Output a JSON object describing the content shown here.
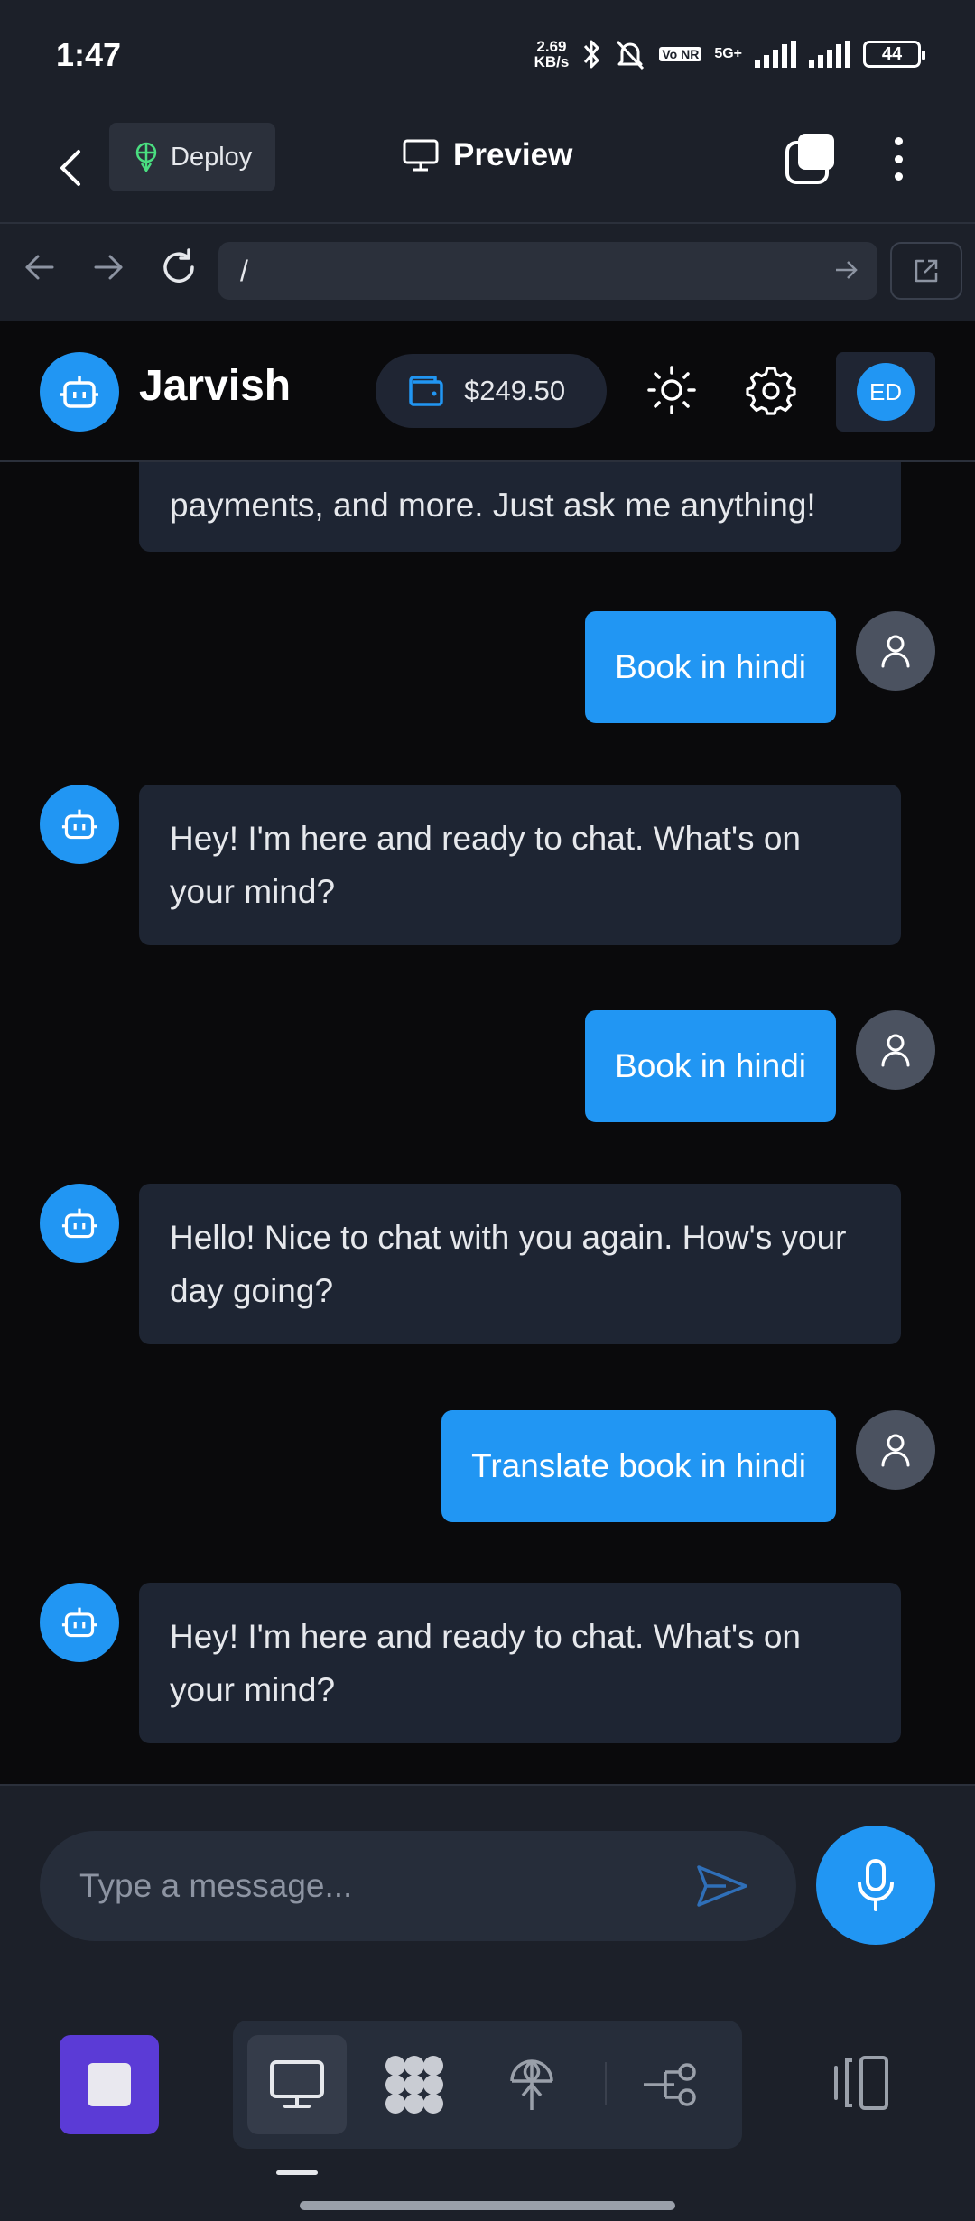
{
  "status_bar": {
    "time": "1:47",
    "net_speed_value": "2.69",
    "net_speed_unit": "KB/s",
    "volte": "Vo NR",
    "network": "5G+",
    "battery": "44"
  },
  "top_bar": {
    "deploy_label": "Deploy",
    "preview_label": "Preview"
  },
  "browser": {
    "url": "/"
  },
  "app": {
    "title": "Jarvish",
    "balance": "$249.50",
    "user_initials": "ED"
  },
  "messages": [
    {
      "role": "bot",
      "text": "payments, and more. Just ask me anything!"
    },
    {
      "role": "user",
      "text": "Book in hindi"
    },
    {
      "role": "bot",
      "text": "Hey! I'm here and ready to chat. What's on your mind?"
    },
    {
      "role": "user",
      "text": "Book in hindi"
    },
    {
      "role": "bot",
      "text": "Hello! Nice to chat with you again. How's your day going?"
    },
    {
      "role": "user",
      "text": "Translate book in hindi"
    },
    {
      "role": "bot",
      "text": "Hey! I'm here and ready to chat. What's on your mind?"
    }
  ],
  "composer": {
    "placeholder": "Type a message..."
  },
  "colors": {
    "accent": "#2196f3",
    "stop_button": "#5b3bd6",
    "panel_bg": "#1c2029",
    "bubble_bot": "#1e2533"
  },
  "icons": [
    "back-icon",
    "deploy-icon",
    "monitor-icon",
    "tabs-icon",
    "more-icon",
    "arrow-left-icon",
    "arrow-right-icon",
    "reload-icon",
    "external-link-icon",
    "robot-icon",
    "wallet-icon",
    "sun-icon",
    "gear-icon",
    "user-icon",
    "send-icon",
    "mic-icon",
    "stop-icon",
    "grid-icon",
    "globe-icon",
    "flow-icon",
    "panel-icon"
  ]
}
